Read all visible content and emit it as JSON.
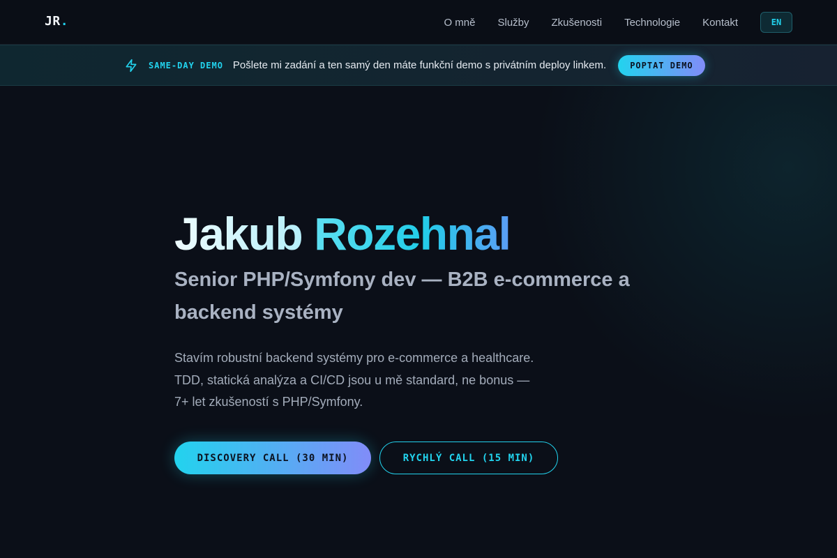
{
  "theme": {
    "background": "#0b0f18",
    "accent": "#22d3ee",
    "accent_secondary": "#818cf8"
  },
  "navbar": {
    "logo_text": "JR",
    "logo_dot": ".",
    "links": [
      "O mně",
      "Služby",
      "Zkušenosti",
      "Technologie",
      "Kontakt"
    ],
    "language_button": "EN"
  },
  "banner": {
    "icon": "lightning-bolt-icon",
    "tag": "SAME-DAY DEMO",
    "text": "Pošlete mi zadání a ten samý den máte funkční demo s privátním deploy linkem.",
    "button_label": "POPTAT DEMO"
  },
  "hero": {
    "title_first": "Jakub",
    "title_last": "Rozehnal",
    "subtitle": "Senior PHP/Symfony dev — B2B e-commerce a backend systémy",
    "description_lines": [
      "Stavím robustní backend systémy pro e-commerce a healthcare.",
      "TDD, statická analýza a CI/CD jsou u mě standard, ne bonus —",
      "7+ let zkušeností s PHP/Symfony."
    ],
    "primary_cta": "DISCOVERY CALL (30 MIN)",
    "secondary_cta": "RYCHLÝ CALL (15 MIN)"
  }
}
